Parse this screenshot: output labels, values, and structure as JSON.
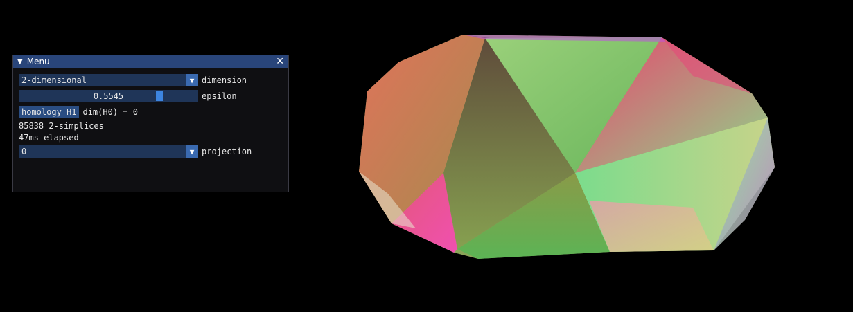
{
  "window": {
    "title": "Menu",
    "collapse_glyph": "▼",
    "close_glyph": "✕"
  },
  "dimension": {
    "selected": "2-dimensional",
    "label": "dimension"
  },
  "epsilon": {
    "value_text": "0.5545",
    "value": 0.5545,
    "label": "epsilon"
  },
  "homology": {
    "button_label": "homology H1",
    "result": "dim(H0) = 0"
  },
  "stats": {
    "simplices": "85838 2-simplices",
    "elapsed": "47ms elapsed"
  },
  "projection": {
    "selected": "0",
    "label": "projection"
  },
  "combo_arrow_glyph": "▼",
  "colors": {
    "titlebar": "#29457a",
    "frame_bg": "#1f3558",
    "button": "#2a4d82",
    "slider_grab": "#3d85e0",
    "panel_bg": "#0f0f12",
    "background": "#000000"
  }
}
